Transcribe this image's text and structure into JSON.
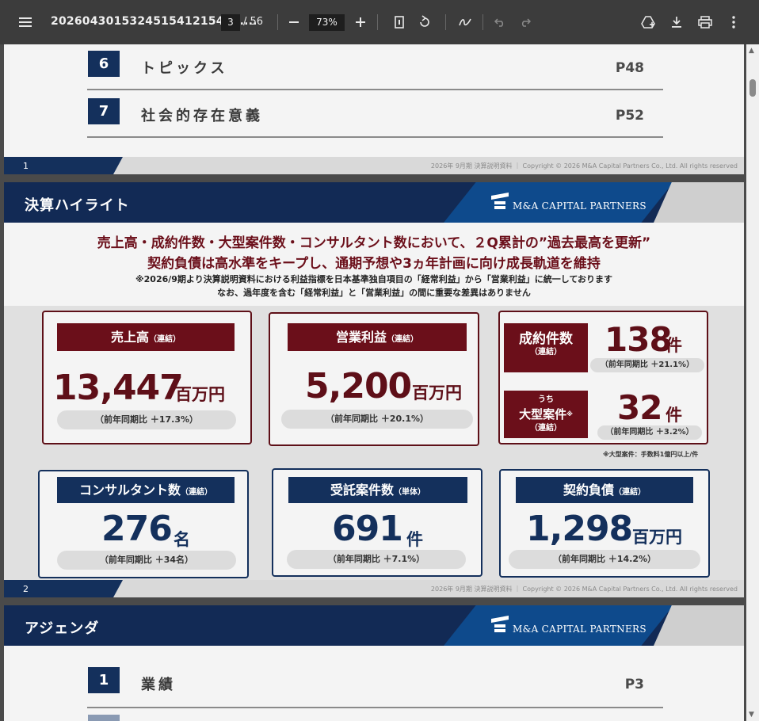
{
  "toolbar": {
    "filename": "202604301532451541215437....",
    "page_current": "3",
    "page_total": "/ 56",
    "zoom": "73%",
    "icons": [
      "menu-icon",
      "zoom-out-icon",
      "zoom-in-icon",
      "fit-page-icon",
      "rotate-icon",
      "annotate-icon",
      "undo-icon",
      "redo-icon",
      "add-to-drive-icon",
      "download-icon",
      "print-icon",
      "more-icon"
    ]
  },
  "page1": {
    "rows": [
      {
        "num": "6",
        "title": "トピックス",
        "page": "P48"
      },
      {
        "num": "7",
        "title": "社会的存在意義",
        "page": "P52"
      }
    ],
    "footer_num": "1",
    "footer_copy": "2026年 9月期 決算説明資料 ｜ Copyright © 2026 M&A Capital Partners Co., Ltd. All rights reserved"
  },
  "page2": {
    "title": "決算ハイライト",
    "logo": "M&A CAPITAL PARTNERS",
    "headline1": "売上高・成約件数・大型案件数・コンサルタント数において、２Q累計の”過去最高を更新”",
    "headline2": "契約負債は高水準をキープし、通期予想や3ヵ年計画に向け成長軌道を維持",
    "note1": "※2026/9期より決算説明資料における利益指標を日本基準独自項目の「経常利益」から「営業利益」に統一しております",
    "note2": "なお、過年度を含む「経常利益」と「営業利益」の間に重要な差異はありません",
    "sales": {
      "label": "売上高",
      "sub": "（連結）",
      "value": "13,447",
      "unit": "百万円",
      "yoy": "（前年同期比 ＋17.3%）"
    },
    "op": {
      "label": "営業利益",
      "sub": "（連結）",
      "value": "5,200",
      "unit": "百万円",
      "yoy": "（前年同期比 ＋20.1%）"
    },
    "deals": {
      "label": "成約件数",
      "sub": "（連結）",
      "value": "138",
      "unit": "件",
      "yoy": "（前年同期比 ＋21.1%）"
    },
    "large": {
      "pre": "うち",
      "label": "大型案件",
      "mark": "※",
      "sub": "（連結）",
      "value": "32",
      "unit": "件",
      "yoy": "（前年同期比 ＋3.2%）"
    },
    "large_note": "※大型案件：手数料1億円以上/件",
    "consultants": {
      "label": "コンサルタント数",
      "sub": "（連結）",
      "value": "276",
      "unit": "名",
      "yoy": "（前年同期比 ＋34名）"
    },
    "mandates": {
      "label": "受託案件数",
      "sub": "（単体）",
      "value": "691",
      "unit": "件",
      "yoy": "（前年同期比 ＋7.1%）"
    },
    "liab": {
      "label": "契約負債",
      "sub": "（連結）",
      "value": "1,298",
      "unit": "百万円",
      "yoy": "（前年同期比 ＋14.2%）"
    },
    "footer_num": "2",
    "footer_copy": "2026年 9月期 決算説明資料 ｜ Copyright © 2026 M&A Capital Partners Co., Ltd. All rights reserved"
  },
  "page3": {
    "title": "アジェンダ",
    "logo": "M&A CAPITAL PARTNERS",
    "rows": [
      {
        "num": "1",
        "title": "業績",
        "page": "P3"
      }
    ]
  }
}
